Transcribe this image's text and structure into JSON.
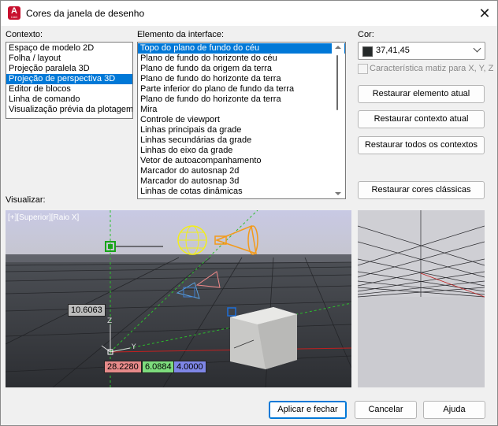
{
  "title": "Cores da janela de desenho",
  "app_icon_letter": "A",
  "app_icon_sub": "CAD",
  "contexts": {
    "label": "Contexto:",
    "items": [
      "Espaço de modelo 2D",
      "Folha / layout",
      "Projeção paralela 3D",
      "Projeção de perspectiva 3D",
      "Editor de blocos",
      "Linha de comando",
      "Visualização prévia da plotagem"
    ],
    "selected_index": 3
  },
  "elements": {
    "label": "Elemento da interface:",
    "items": [
      "Topo do plano de fundo do céu",
      "Plano de fundo do horizonte do céu",
      "Plano de fundo da origem da terra",
      "Plano de fundo do horizonte da terra",
      "Parte inferior do plano de fundo da terra",
      "Plano de fundo do horizonte da terra",
      "Mira",
      "Controle de viewport",
      "Linhas principais da grade",
      "Linhas secundárias da grade",
      "Linhas do eixo da grade",
      "Vetor de autoacompanhamento",
      "Marcador do autosnap 2d",
      "Marcador do autosnap 3d",
      "Linhas de cotas dinâmicas"
    ],
    "selected_index": 0
  },
  "color": {
    "label": "Cor:",
    "value": "37,41,45",
    "swatch": "#252929"
  },
  "tint_checkbox": {
    "label": "Característica matiz para X, Y, Z",
    "checked": false
  },
  "buttons": {
    "restore_element": "Restaurar elemento atual",
    "restore_context": "Restaurar contexto atual",
    "restore_all": "Restaurar todos os contextos",
    "restore_classic": "Restaurar cores clássicas",
    "apply_close": "Aplicar e fechar",
    "cancel": "Cancelar",
    "help": "Ajuda"
  },
  "preview": {
    "label": "Visualizar:",
    "viewport_title": "[+][Superior][Raio X]",
    "dim_value": "10.6063",
    "coord_x": "28.2280",
    "coord_y": "6.0884",
    "coord_z": "4.0000"
  },
  "colors": {
    "accent": "#0078d7",
    "sky": "#c9cbe3",
    "ground": "#3a3d42"
  }
}
